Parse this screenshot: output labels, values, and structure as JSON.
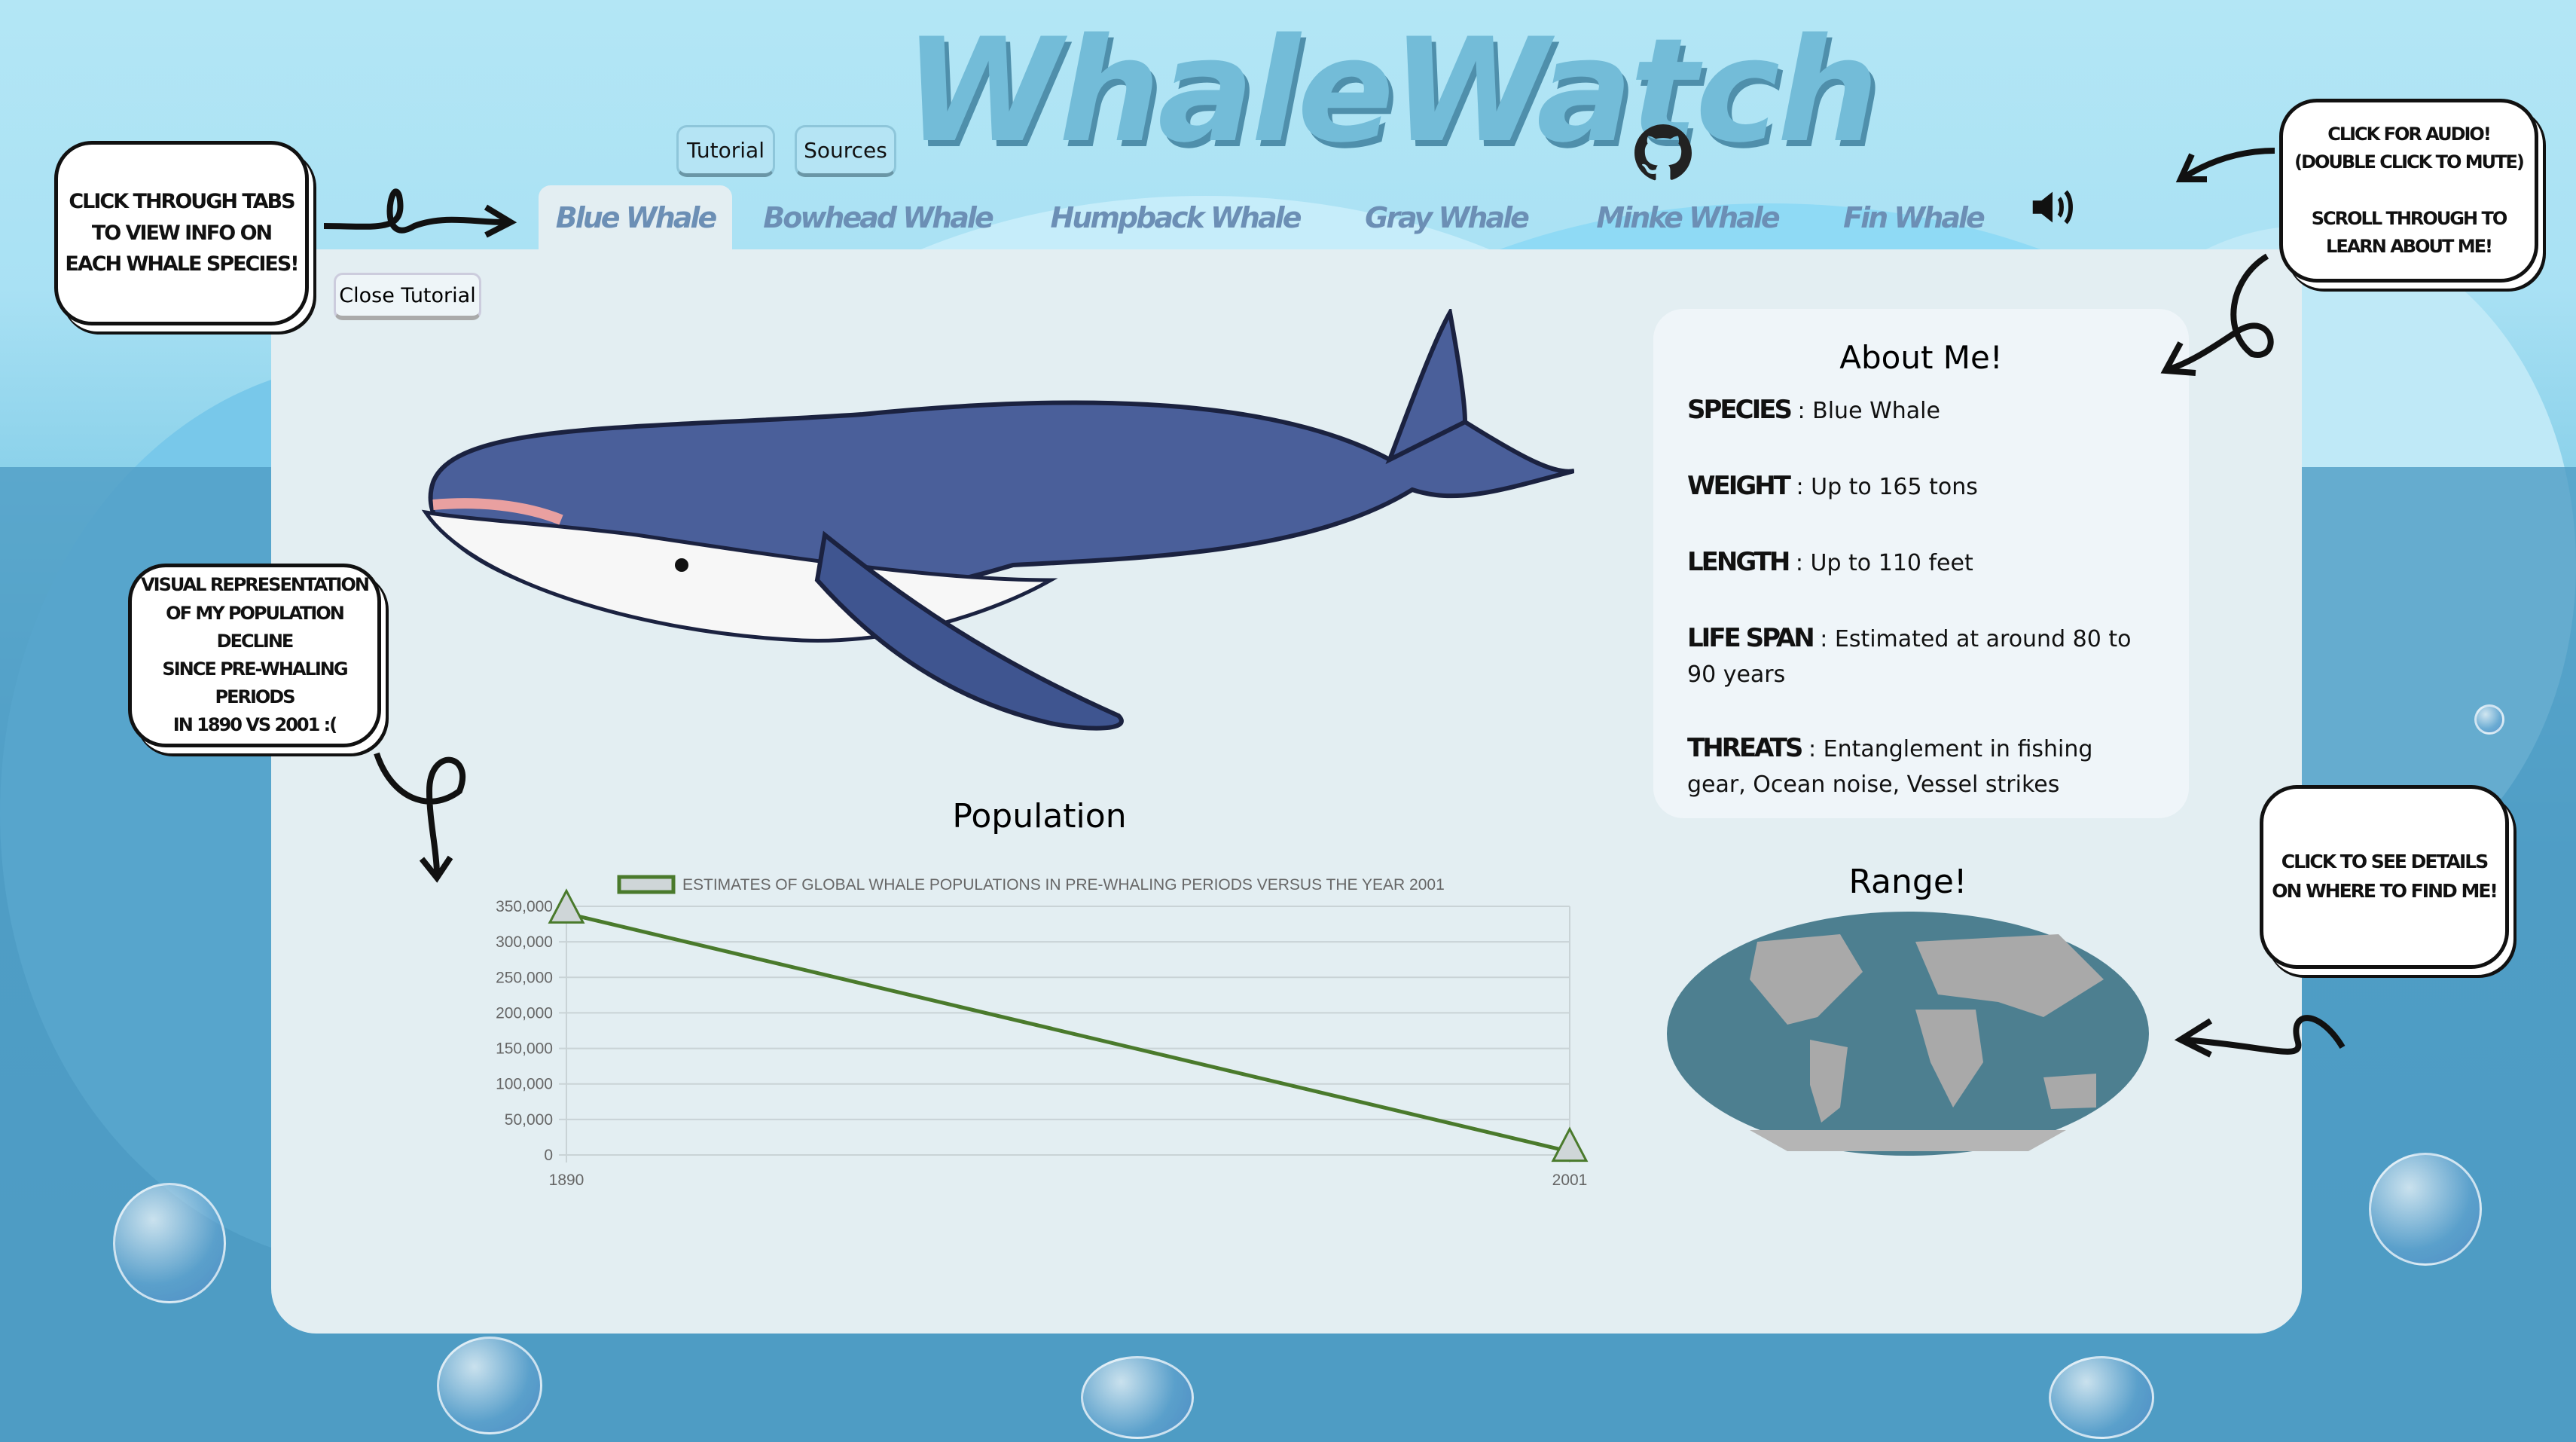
{
  "app": {
    "title": "WhaleWatch"
  },
  "header": {
    "tutorial_label": "Tutorial",
    "sources_label": "Sources",
    "github_icon": "github-icon",
    "audio_icon": "speaker-icon"
  },
  "tabs": [
    {
      "label": "Blue Whale",
      "active": true
    },
    {
      "label": "Bowhead Whale"
    },
    {
      "label": "Humpback Whale"
    },
    {
      "label": "Gray Whale"
    },
    {
      "label": "Minke Whale"
    },
    {
      "label": "Fin Whale"
    }
  ],
  "tutorial": {
    "close_label": "Close Tutorial",
    "callout_tabs": "Click through tabs\nto view info on\neach whale species!",
    "callout_chart": "Visual representation\nof my population decline\nsince pre-whaling periods\nin 1890 vs 2001 :(",
    "callout_audio": "Click for audio!\n(double click to mute)\n\nScroll through to\nlearn about me!",
    "callout_range": "Click to see details\non where to find me!"
  },
  "about": {
    "title": "About Me!",
    "rows": [
      {
        "key": "SPECIES",
        "value": "Blue Whale"
      },
      {
        "key": "WEIGHT",
        "value": "Up to 165 tons"
      },
      {
        "key": "LENGTH",
        "value": "Up to 110 feet"
      },
      {
        "key": "LIFE SPAN",
        "value": "Estimated at around 80 to 90 years"
      },
      {
        "key": "THREATS",
        "value": "Entanglement in fishing gear, Ocean noise, Vessel strikes"
      }
    ]
  },
  "range": {
    "title": "Range!"
  },
  "population": {
    "title": "Population"
  },
  "colors": {
    "line": "#4a7a2c",
    "whale": "#4a5f9a",
    "panel": "#e3eef2"
  },
  "chart_data": {
    "type": "line",
    "title": "Population",
    "legend": "ESTIMATES OF GLOBAL WHALE POPULATIONS IN PRE-WHALING PERIODS VERSUS THE YEAR 2001",
    "legend_position": "top",
    "categories": [
      "1890",
      "2001"
    ],
    "values": [
      340000,
      4700
    ],
    "ylim": [
      0,
      350000
    ],
    "yticks": [
      "0",
      "50,000",
      "100,000",
      "150,000",
      "200,000",
      "250,000",
      "300,000",
      "350,000"
    ],
    "grid": true
  }
}
